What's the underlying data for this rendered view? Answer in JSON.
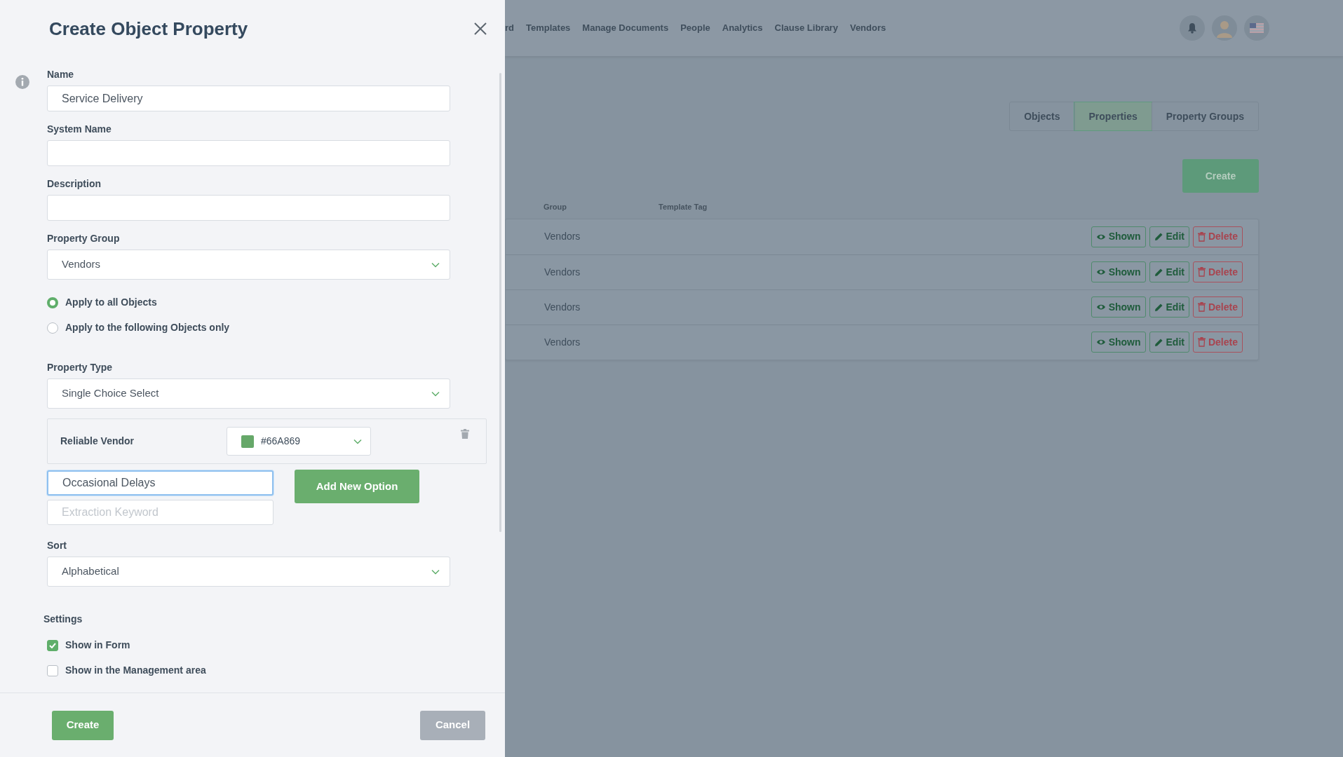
{
  "dialog": {
    "title": "Create Object Property",
    "fields": [
      {
        "label": "Name",
        "value": "Service Delivery"
      },
      {
        "label": "System Name"
      },
      {
        "label": "Description"
      }
    ],
    "property_group": {
      "label": "Property Group",
      "value": "Vendors"
    },
    "apply_options": [
      {
        "label": "Apply to all Objects",
        "selected": true
      },
      {
        "label": "Apply to the following Objects only",
        "selected": false
      }
    ],
    "property_type": {
      "label": "Property Type",
      "value": "Single Choice Select"
    },
    "options": [
      {
        "label": "Reliable Vendor",
        "color": "#66a869",
        "color_label": "#66A869"
      }
    ],
    "new_option": {
      "value": "Occasional Delays",
      "keyword_placeholder": "Extraction Keyword",
      "button": "Add New Option"
    },
    "sort": {
      "label": "Sort",
      "value": "Alphabetical"
    },
    "settings": {
      "title": "Settings",
      "items": [
        {
          "label": "Show in Form",
          "checked": true
        },
        {
          "label": "Show in the Management area",
          "checked": false
        }
      ]
    },
    "buttons": {
      "create": "Create",
      "cancel": "Cancel"
    }
  },
  "background": {
    "nav": [
      "rd",
      "Templates",
      "Manage Documents",
      "People",
      "Analytics",
      "Clause Library",
      "Vendors"
    ],
    "tabs": [
      {
        "label": "Objects",
        "selected": false
      },
      {
        "label": "Properties",
        "selected": true
      },
      {
        "label": "Property Groups",
        "selected": false
      }
    ],
    "create_button": "Create",
    "columns": [
      "Group",
      "Template Tag"
    ],
    "rows": [
      {
        "group": "Vendors",
        "shown": "Shown",
        "edit": "Edit",
        "delete": "Delete"
      },
      {
        "group": "Vendors",
        "shown": "Shown",
        "edit": "Edit",
        "delete": "Delete"
      },
      {
        "group": "Vendors",
        "shown": "Shown",
        "edit": "Edit",
        "delete": "Delete"
      },
      {
        "group": "Vendors",
        "shown": "Shown",
        "edit": "Edit",
        "delete": "Delete"
      }
    ]
  }
}
